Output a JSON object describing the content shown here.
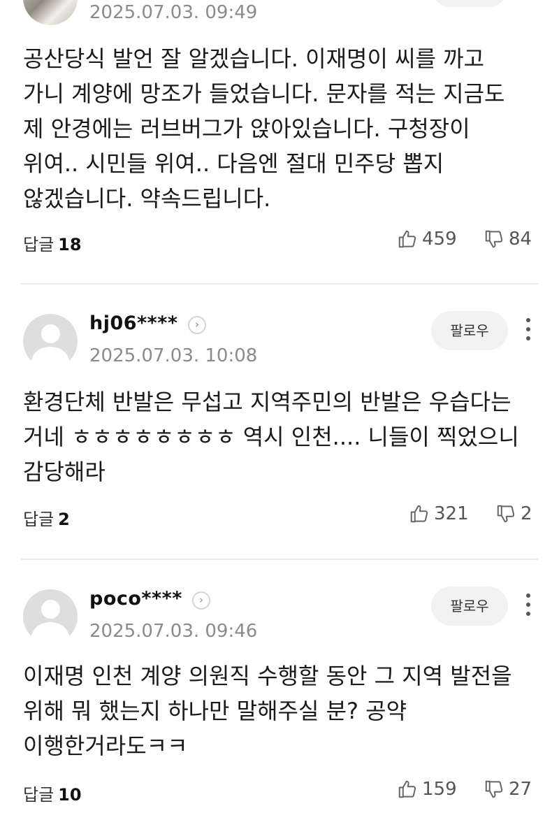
{
  "comments": [
    {
      "date": "2025.07.03. 09:49",
      "body": "공산당식 발언 잘 알겠습니다. 이재명이 씨를 까고 가니 계양에 망조가 들었습니다. 문자를 적는 지금도 제 안경에는 러브버그가 앉아있습니다. 구청장이 위여.. 시민들 위여.. 다음엔 절대 민주당 뽑지 않겠습니다. 약속드립니다.",
      "reply_label": "답글",
      "reply_count": "18",
      "likes": "459",
      "dislikes": "84"
    },
    {
      "username": "hj06****",
      "follow_label": "팔로우",
      "date": "2025.07.03. 10:08",
      "body": "환경단체 반발은 무섭고 지역주민의 반발은 우습다는 거네 ㅎㅎㅎㅎㅎㅎㅎㅎ 역시 인천.... 니들이 찍었으니 감당해라",
      "reply_label": "답글",
      "reply_count": "2",
      "likes": "321",
      "dislikes": "2"
    },
    {
      "username": "poco****",
      "follow_label": "팔로우",
      "date": "2025.07.03. 09:46",
      "body": "이재명 인천 계양 의원직 수행할 동안 그 지역 발전을 위해 뭐 했는지 하나만 말해주실 분? 공약 이행한거라도ㅋㅋ",
      "reply_label": "답글",
      "reply_count": "10",
      "likes": "159",
      "dislikes": "27"
    }
  ],
  "icons": {
    "thumbs_up": "thumbs-up-icon",
    "thumbs_down": "thumbs-down-icon",
    "profile_arrow": "chevron-right-icon",
    "more": "more-vertical-icon"
  }
}
